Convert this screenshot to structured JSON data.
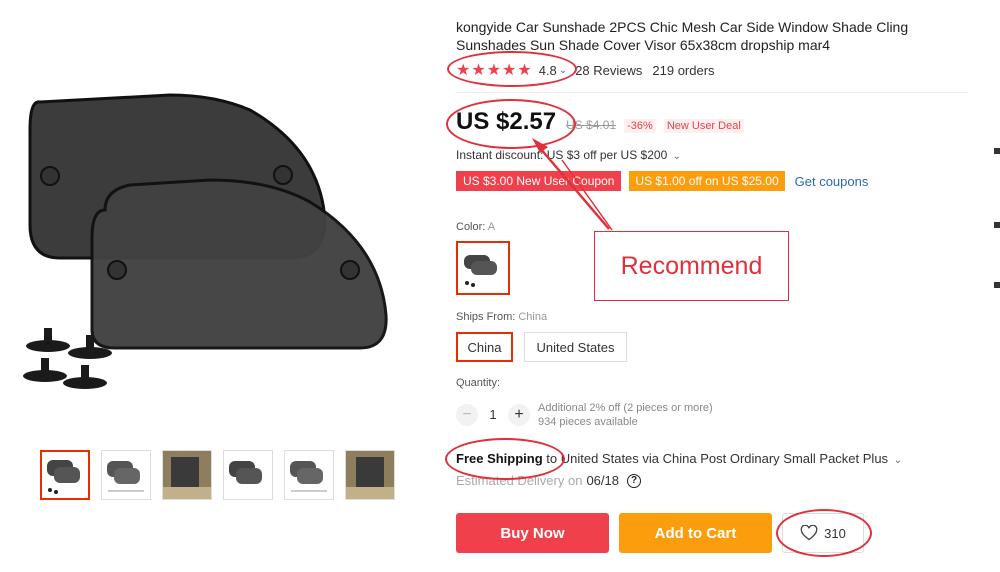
{
  "product": {
    "title": "kongyide Car Sunshade 2PCS Chic Mesh Car Side Window Shade Cling Sunshades Sun Shade Cover Visor 65x38cm dropship mar4",
    "rating": "4.8",
    "reviews": "28 Reviews",
    "orders": "219 orders",
    "stars": "★★★★★"
  },
  "price": {
    "current": "US $2.57",
    "original": "US $4.01",
    "discount": "-36%",
    "deal": "New User Deal",
    "instant_discount": "Instant discount: US $3 off per US $200"
  },
  "coupons": {
    "new_user": "US $3.00 New User Coupon",
    "off": "US $1.00 off on US $25.00",
    "get": "Get coupons"
  },
  "color": {
    "label": "Color:",
    "value": "A"
  },
  "ships": {
    "label": "Ships From:",
    "value": "China",
    "options": [
      "China",
      "United States"
    ]
  },
  "quantity": {
    "label": "Quantity:",
    "value": "1",
    "minus": "−",
    "plus": "+",
    "info_line1": "Additional 2% off (2 pieces or more)",
    "info_line2": "934 pieces available"
  },
  "shipping": {
    "free": "Free Shipping",
    "text": " to United States via China Post Ordinary Small Packet Plus",
    "est_label": "Estimated Delivery on",
    "est_date": "06/18",
    "help": "?"
  },
  "actions": {
    "buy": "Buy Now",
    "cart": "Add to Cart",
    "wishlist_count": "310"
  },
  "annotation": {
    "recommend": "Recommend"
  },
  "colors": {
    "accent": "#f0404b",
    "orange": "#fc9d0d",
    "link": "#2e6aa8",
    "annotation": "#e0303a"
  }
}
